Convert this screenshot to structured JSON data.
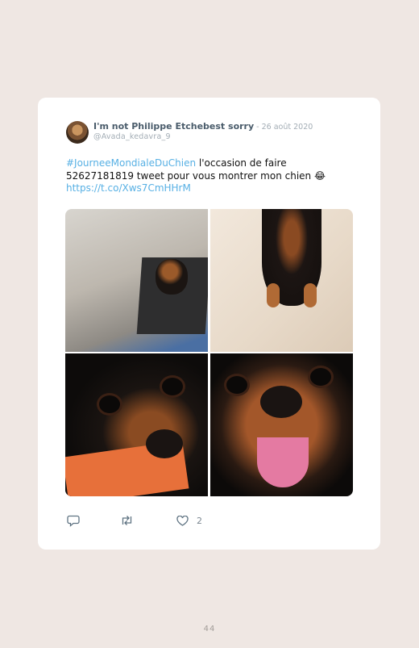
{
  "tweet": {
    "author_name": "I'm not Philippe Etchebest sorry",
    "date": " - 26 août 2020",
    "handle": "@Avada_kedavra_9",
    "hashtag": "#JourneeMondialeDuChien",
    "text_after_hashtag": " l'occasion de faire 52627181819 tweet pour vous montrer mon chien 😂",
    "link": "https://t.co/Xws7CmHHrM",
    "likes": "2",
    "icons": [
      "reply-icon",
      "retweet-icon",
      "heart-icon"
    ],
    "link_color": "#57b0e4"
  },
  "page": {
    "number": "44"
  }
}
